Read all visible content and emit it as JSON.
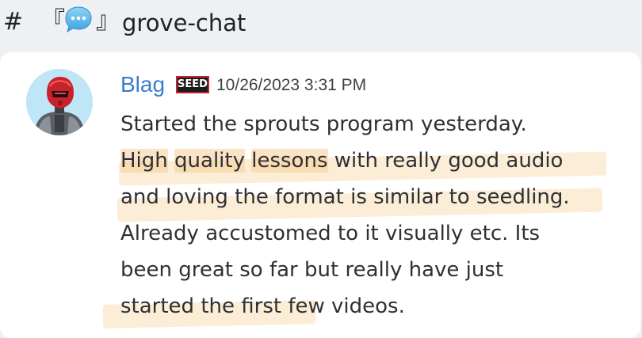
{
  "channel": {
    "hash": "#",
    "bracket_left": "『",
    "bracket_right": "』",
    "name": "grove-chat",
    "icon": "chat-bubble-icon"
  },
  "message": {
    "author": "Blag",
    "role_badge": "SEED",
    "timestamp": "10/26/2023 3:31 PM",
    "avatar_icon": "robot-avatar",
    "lines": [
      [
        "Started the sprouts program yesterday."
      ],
      [
        "High",
        " ",
        "quality",
        " ",
        "lessons",
        " with really good audio"
      ],
      [
        "and loving the format is similar to seedling."
      ],
      [
        "Already accustomed to it visually etc. Its"
      ],
      [
        "been great so far",
        " but really have just"
      ],
      [
        "started the first few videos."
      ]
    ],
    "highlight_color": "#f5cd96",
    "author_color": "#3a7ec9"
  }
}
